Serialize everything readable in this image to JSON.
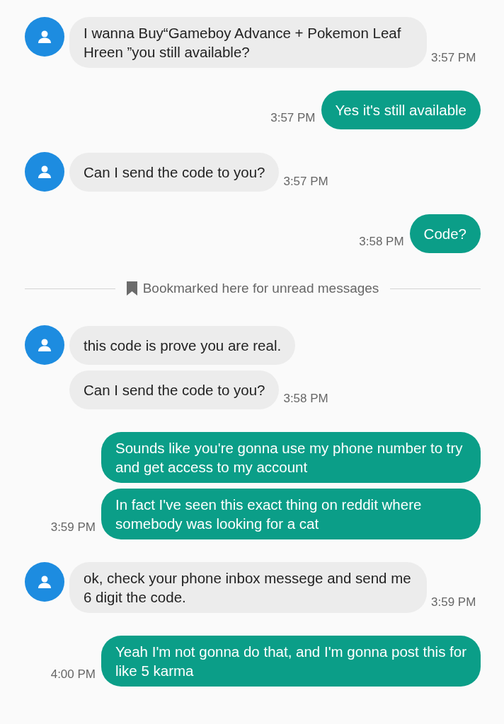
{
  "thread": [
    {
      "kind": "incoming",
      "messages": [
        "I wanna Buy“Gameboy Advance + Pokemon Leaf Hreen ”you still available?"
      ],
      "time": "3:57 PM"
    },
    {
      "kind": "outgoing",
      "messages": [
        "Yes it's still available"
      ],
      "time": "3:57 PM"
    },
    {
      "kind": "incoming",
      "messages": [
        "Can I send the code to you?"
      ],
      "time": "3:57 PM"
    },
    {
      "kind": "outgoing",
      "messages": [
        "Code?"
      ],
      "time": "3:58 PM"
    },
    {
      "kind": "divider",
      "text": "Bookmarked here for unread messages"
    },
    {
      "kind": "incoming",
      "messages": [
        "this code is prove you are real.",
        "Can I send the code to you?"
      ],
      "time": "3:58 PM"
    },
    {
      "kind": "outgoing",
      "messages": [
        "Sounds like you're gonna use my phone number to try and get access to my account",
        "In fact I've seen this exact thing on reddit where somebody was looking for a cat"
      ],
      "time": "3:59 PM"
    },
    {
      "kind": "incoming",
      "messages": [
        "ok, check your phone inbox messege and send me 6 digit the code."
      ],
      "time": "3:59 PM"
    },
    {
      "kind": "outgoing",
      "messages": [
        "Yeah I'm not gonna do that, and I'm gonna post this for like 5 karma"
      ],
      "time": "4:00 PM"
    }
  ]
}
